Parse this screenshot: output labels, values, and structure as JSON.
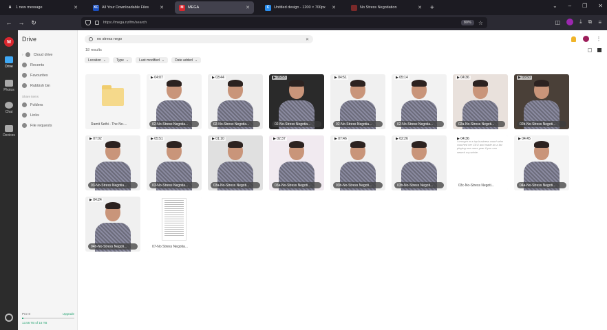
{
  "browser": {
    "tabs": [
      {
        "icon_letter": "A",
        "icon_color": "#1c1b22",
        "title": "1 new message"
      },
      {
        "icon_letter": "XC",
        "icon_color": "#1a4fbf",
        "title": "All Your Downloadable Files"
      },
      {
        "icon_letter": "M",
        "icon_color": "#d9272e",
        "title": "MEGA",
        "active": true
      },
      {
        "icon_letter": "C",
        "icon_color": "#2b8ff0",
        "title": "Untitled design - 1200 × 700px"
      },
      {
        "icon_letter": "",
        "icon_color": "#7a2a2a",
        "title": "No Stress Negotiation"
      }
    ],
    "url": "https://mega.nz/fm/search",
    "zoom": "80%"
  },
  "rail": {
    "logo": "M",
    "items": [
      {
        "label": "Drive",
        "active": true
      },
      {
        "label": "Photos"
      },
      {
        "label": "Chat"
      },
      {
        "label": "Devices"
      }
    ]
  },
  "sidebar": {
    "title": "Drive",
    "items": [
      "Cloud drive",
      "Recents",
      "Favourites",
      "Rubbish bin"
    ],
    "section": "Share items",
    "share_items": [
      "Folders",
      "Links",
      "File requests"
    ],
    "storage": {
      "plan": "Pro III",
      "upgrade": "Upgrade",
      "used": "13.56 TB of 16 TB",
      "used_fraction": 0.03
    }
  },
  "main": {
    "search_value": "no stress nego",
    "results": "18 results",
    "filters": [
      "Location",
      "Type",
      "Last modified",
      "Date added"
    ],
    "items": [
      {
        "kind": "folder",
        "name": "Ramit Sethi - The No-..."
      },
      {
        "kind": "video",
        "duration": "04:07",
        "name": "02-No-Stress Negotia..."
      },
      {
        "kind": "video",
        "duration": "03:44",
        "name": "02-No-Stress Negotia..."
      },
      {
        "kind": "video",
        "duration": "06:53",
        "name": "02-No-Stress Negotia..."
      },
      {
        "kind": "video",
        "duration": "04:51",
        "name": "02-No-Stress Negotia..."
      },
      {
        "kind": "video",
        "duration": "05:14",
        "name": "02-No-Stress Negotia..."
      },
      {
        "kind": "video",
        "duration": "04:36",
        "name": "02a-No-Stress Negoti..."
      },
      {
        "kind": "video",
        "duration": "03:50",
        "name": "02b-No-Stress Negoti..."
      },
      {
        "kind": "video",
        "duration": "07:02",
        "name": "03-No-Stress Negotia..."
      },
      {
        "kind": "video",
        "duration": "05:51",
        "name": "03-No-Stress Negotia..."
      },
      {
        "kind": "video",
        "duration": "01:10",
        "name": "03a-No-Stress Negoti..."
      },
      {
        "kind": "video",
        "duration": "02:37",
        "name": "03a-No-Stress Negoti..."
      },
      {
        "kind": "video",
        "duration": "07:46",
        "name": "03b-No-Stress Negoti..."
      },
      {
        "kind": "video",
        "duration": "02:26",
        "name": "03b-No-Stress Negoti..."
      },
      {
        "kind": "doc",
        "duration": "04:36",
        "name": "03c-No-Stress Negoti...",
        "text": "I brought in a top business coach who coached her CEO and made an a list playing one more year if you can search my whole."
      },
      {
        "kind": "video",
        "duration": "04:45",
        "name": "04a-No-Stress Negoti..."
      },
      {
        "kind": "video",
        "duration": "04:24",
        "name": "04b-No-Stress Negoti..."
      },
      {
        "kind": "page",
        "name": "07-No Stress Negotia..."
      }
    ]
  }
}
